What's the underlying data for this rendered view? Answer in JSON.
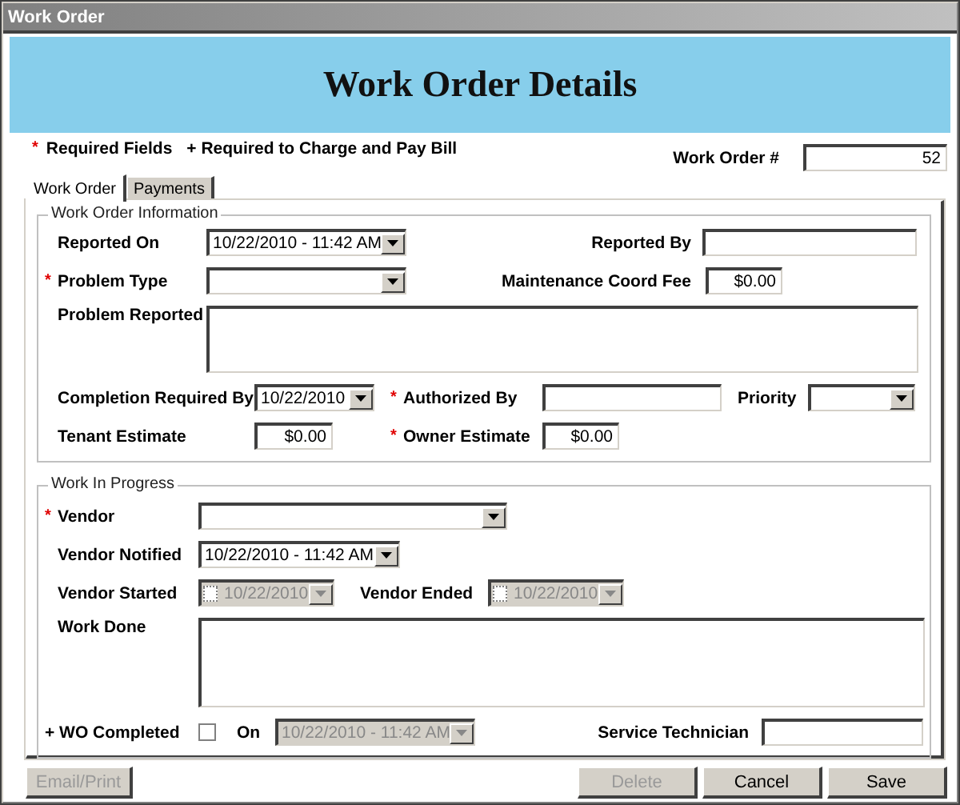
{
  "window": {
    "title": "Work Order"
  },
  "header": {
    "title": "Work Order Details"
  },
  "legend": {
    "marker": "*",
    "required": "Required Fields",
    "charge": "+ Required to Charge and Pay Bill"
  },
  "work_order_number": {
    "label": "Work Order #",
    "value": "52"
  },
  "tabs": [
    {
      "label": "Work Order",
      "selected": true
    },
    {
      "label": "Payments",
      "selected": false
    }
  ],
  "work_order_information": {
    "title": "Work Order Information",
    "reported_on": {
      "label": "Reported On",
      "value": "10/22/2010 - 11:42 AM"
    },
    "reported_by": {
      "label": "Reported By"
    },
    "problem_type": {
      "label": "Problem Type",
      "marker": "*"
    },
    "maintenance_coord_fee": {
      "label": "Maintenance Coord Fee",
      "value": "$0.00"
    },
    "problem_reported": {
      "label": "Problem Reported"
    },
    "completion_required_by": {
      "label": "Completion Required By",
      "value": "10/22/2010"
    },
    "authorized_by": {
      "label": "Authorized By",
      "marker": "*"
    },
    "priority": {
      "label": "Priority"
    },
    "tenant_estimate": {
      "label": "Tenant Estimate",
      "value": "$0.00"
    },
    "owner_estimate": {
      "label": "Owner Estimate",
      "marker": "*",
      "value": "$0.00"
    }
  },
  "work_in_progress": {
    "title": "Work In Progress",
    "vendor": {
      "label": "Vendor",
      "marker": "*"
    },
    "vendor_notified": {
      "label": "Vendor Notified",
      "value": "10/22/2010 - 11:42 AM"
    },
    "vendor_started": {
      "label": "Vendor Started",
      "value": "10/22/2010",
      "checked": false,
      "disabled": true
    },
    "vendor_ended": {
      "label": "Vendor Ended",
      "value": "10/22/2010",
      "checked": false,
      "disabled": true
    },
    "work_done": {
      "label": "Work Done"
    },
    "wo_completed": {
      "label": "+ WO Completed",
      "checked": false
    },
    "on": {
      "label": "On",
      "value": "10/22/2010 - 11:42 AM",
      "disabled": true
    },
    "service_technician": {
      "label": "Service Technician"
    }
  },
  "buttons": [
    {
      "label": "Email/Print",
      "disabled": true
    },
    {
      "label": "Delete",
      "disabled": true
    },
    {
      "label": "Cancel",
      "disabled": false
    },
    {
      "label": "Save",
      "disabled": false
    }
  ]
}
